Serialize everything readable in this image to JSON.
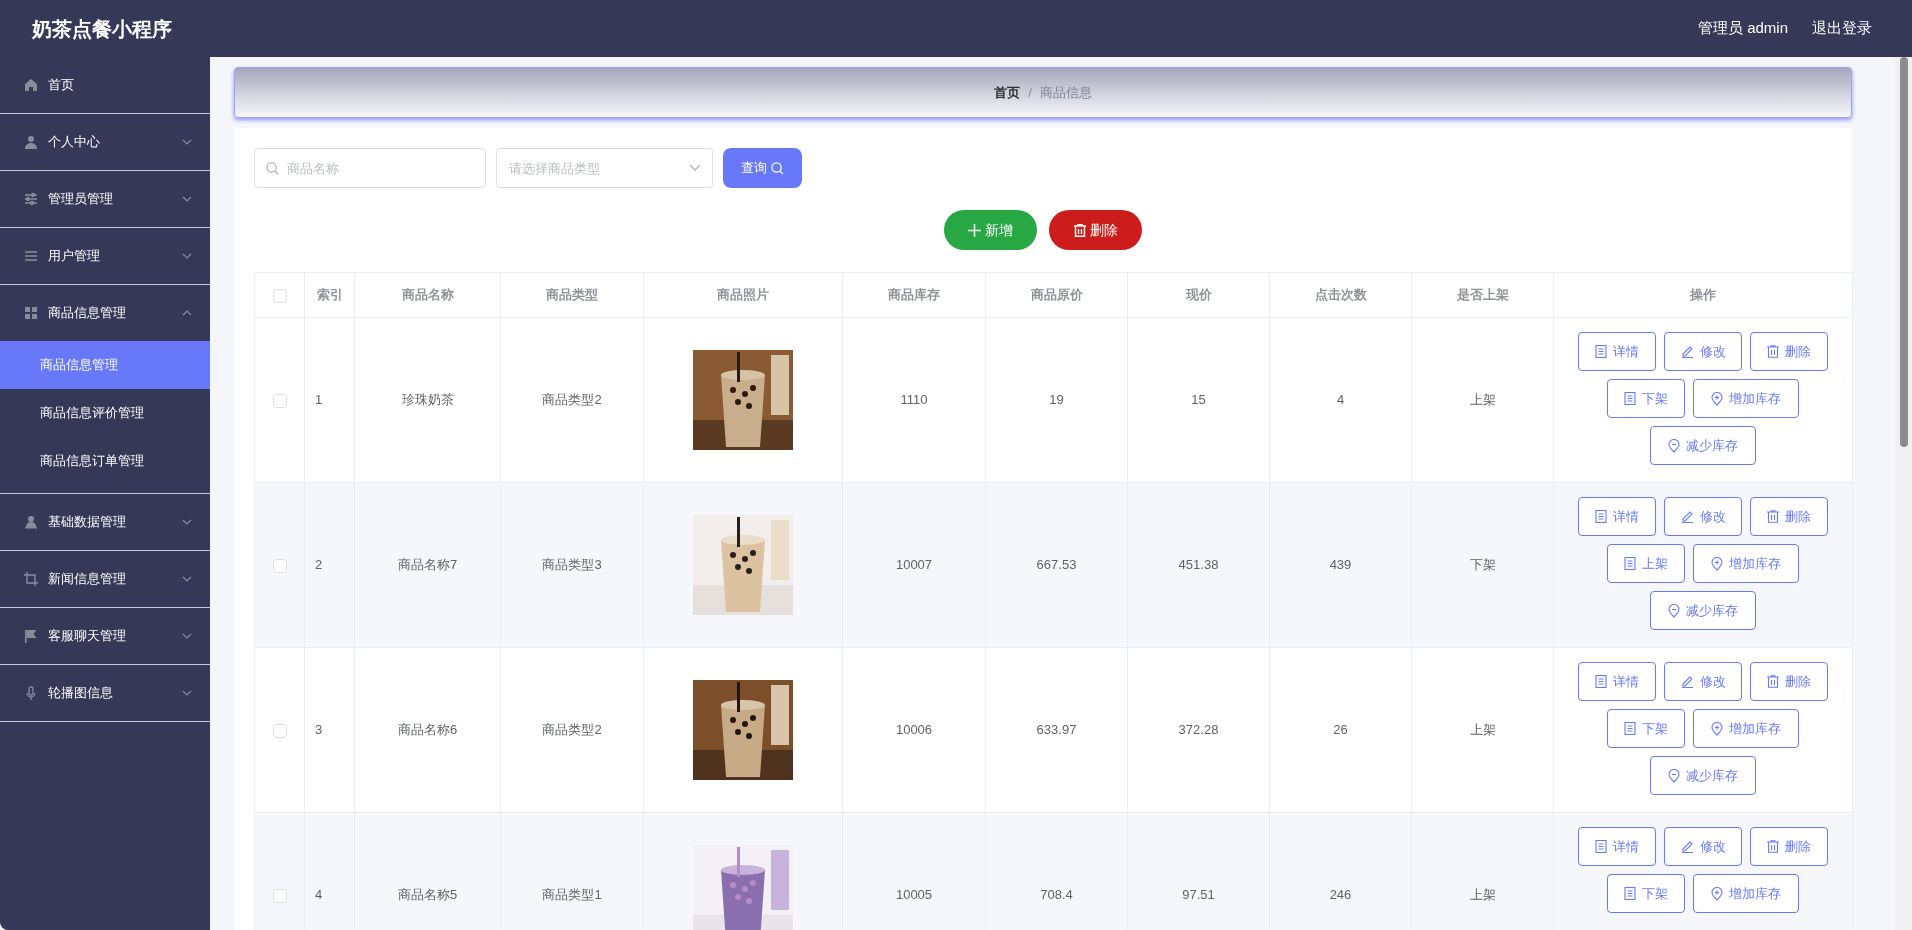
{
  "app": {
    "title": "奶茶点餐小程序",
    "user": "管理员 admin",
    "logout": "退出登录"
  },
  "sidebar": {
    "items": [
      {
        "label": "首页",
        "expandable": false
      },
      {
        "label": "个人中心",
        "expandable": true,
        "expanded": false
      },
      {
        "label": "管理员管理",
        "expandable": true,
        "expanded": false
      },
      {
        "label": "用户管理",
        "expandable": true,
        "expanded": false
      },
      {
        "label": "商品信息管理",
        "expandable": true,
        "expanded": true,
        "children": [
          {
            "label": "商品信息管理",
            "selected": true
          },
          {
            "label": "商品信息评价管理",
            "selected": false
          },
          {
            "label": "商品信息订单管理",
            "selected": false
          }
        ]
      },
      {
        "label": "基础数据管理",
        "expandable": true,
        "expanded": false
      },
      {
        "label": "新闻信息管理",
        "expandable": true,
        "expanded": false
      },
      {
        "label": "客服聊天管理",
        "expandable": true,
        "expanded": false
      },
      {
        "label": "轮播图信息",
        "expandable": true,
        "expanded": false
      }
    ]
  },
  "breadcrumb": [
    "首页",
    "/",
    "商品信息"
  ],
  "filters": {
    "name_placeholder": "商品名称",
    "type_placeholder": "请选择商品类型",
    "query_button": "查询"
  },
  "toolbar": [
    {
      "kind": "add",
      "label": "新增"
    },
    {
      "kind": "delete",
      "label": "删除"
    }
  ],
  "table": {
    "all_checked": false,
    "columns": [
      "索引",
      "商品名称",
      "商品类型",
      "商品照片",
      "商品库存",
      "商品原价",
      "现价",
      "点击次数",
      "是否上架",
      "操作"
    ],
    "rows": [
      {
        "checked": false,
        "index": "1",
        "name": "珍珠奶茶",
        "type": "商品类型2",
        "photo": {
          "kind": "picture"
        },
        "stock": "1110",
        "price": "19",
        "current": "15",
        "clicks": "4",
        "status": "上架",
        "actions": [
          {
            "kind": "detail",
            "label": "详情"
          },
          {
            "kind": "edit",
            "label": "修改"
          },
          {
            "kind": "delete",
            "label": "删除"
          },
          {
            "kind": "shelf",
            "label": "下架"
          },
          {
            "kind": "add-stock",
            "label": "增加库存"
          },
          {
            "kind": "reduce-stock",
            "label": "减少库存"
          }
        ]
      },
      {
        "checked": false,
        "index": "2",
        "name": "商品名称7",
        "type": "商品类型3",
        "photo": {
          "kind": "picture"
        },
        "stock": "10007",
        "price": "667.53",
        "current": "451.38",
        "clicks": "439",
        "status": "下架",
        "actions": [
          {
            "kind": "detail",
            "label": "详情"
          },
          {
            "kind": "edit",
            "label": "修改"
          },
          {
            "kind": "delete",
            "label": "删除"
          },
          {
            "kind": "shelf",
            "label": "上架"
          },
          {
            "kind": "add-stock",
            "label": "增加库存"
          },
          {
            "kind": "reduce-stock",
            "label": "减少库存"
          }
        ]
      },
      {
        "checked": false,
        "index": "3",
        "name": "商品名称6",
        "type": "商品类型2",
        "photo": {
          "kind": "picture"
        },
        "stock": "10006",
        "price": "633.97",
        "current": "372.28",
        "clicks": "26",
        "status": "上架",
        "actions": [
          {
            "kind": "detail",
            "label": "详情"
          },
          {
            "kind": "edit",
            "label": "修改"
          },
          {
            "kind": "delete",
            "label": "删除"
          },
          {
            "kind": "shelf",
            "label": "下架"
          },
          {
            "kind": "add-stock",
            "label": "增加库存"
          },
          {
            "kind": "reduce-stock",
            "label": "减少库存"
          }
        ]
      },
      {
        "checked": false,
        "index": "4",
        "name": "商品名称5",
        "type": "商品类型1",
        "photo": {
          "kind": "picture"
        },
        "stock": "10005",
        "price": "708.4",
        "current": "97.51",
        "clicks": "246",
        "status": "上架",
        "actions": [
          {
            "kind": "detail",
            "label": "详情"
          },
          {
            "kind": "edit",
            "label": "修改"
          },
          {
            "kind": "delete",
            "label": "删除"
          },
          {
            "kind": "shelf",
            "label": "下架"
          },
          {
            "kind": "add-stock",
            "label": "增加库存"
          }
        ]
      }
    ]
  }
}
